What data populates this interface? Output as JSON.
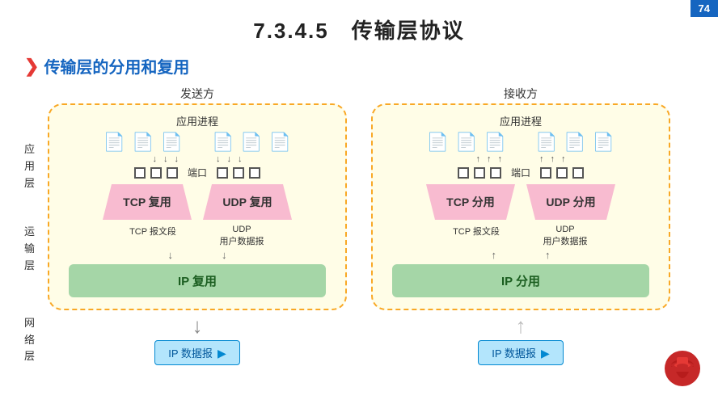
{
  "page": {
    "title": "7.3.4.5　传输层协议",
    "page_num": "74",
    "section_title": "传输层的分用和复用",
    "section_arrow": "❯"
  },
  "sender": {
    "top_label": "发送方",
    "app_label": "应用进程",
    "port_label": "端口",
    "tcp_label": "TCP 复用",
    "udp_label": "UDP 复用",
    "tcp_segment": "TCP 报文段",
    "udp_segment": "UDP\n用户数据报",
    "ip_label": "IP 复用",
    "layer_app": "应\n用\n层",
    "layer_transport": "运\n输\n层",
    "layer_network": "网\n络\n层"
  },
  "receiver": {
    "top_label": "接收方",
    "app_label": "应用进程",
    "port_label": "端口",
    "tcp_label": "TCP 分用",
    "udp_label": "UDP 分用",
    "tcp_segment": "TCP 报文段",
    "udp_segment": "UDP\n用户数据报",
    "ip_label": "IP 分用"
  },
  "bottom": {
    "left_label": "IP 数据报",
    "right_label": "IP 数据报"
  }
}
